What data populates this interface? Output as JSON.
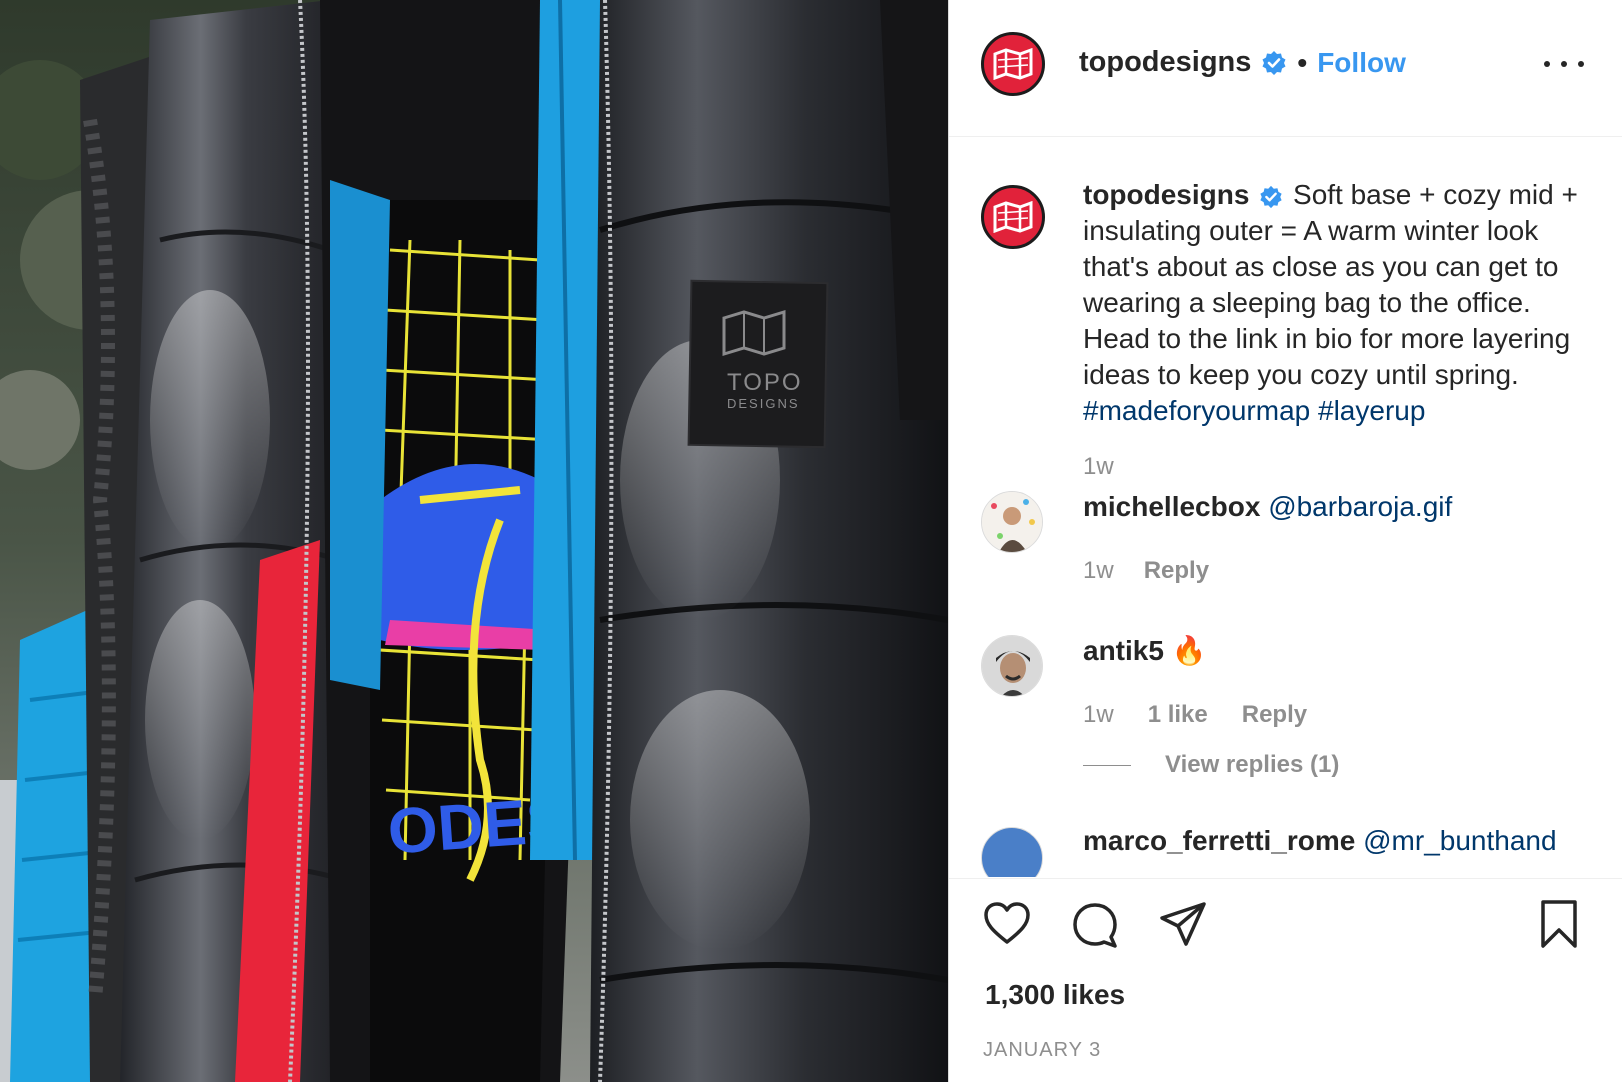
{
  "photo": {
    "logo_line1": "TOPO",
    "logo_line2": "DESIGNS",
    "shirt_text": "ODES"
  },
  "header": {
    "username": "topodesigns",
    "separator": "•",
    "follow_label": "Follow"
  },
  "caption": {
    "username": "topodesigns",
    "text": "Soft base + cozy mid + insulating outer = A warm winter look that's about as close as you can get to wearing a sleeping bag to the office. Head to the link in bio for more layering ideas to keep you cozy until spring.",
    "hashtag1": "#madeforyourmap",
    "hashtag2": "#layerup",
    "time": "1w"
  },
  "comments": [
    {
      "username": "michellecbox",
      "mention": "@barbaroja.gif",
      "time": "1w",
      "reply_label": "Reply"
    },
    {
      "username": "antik5",
      "emoji": "🔥",
      "time": "1w",
      "likes": "1 like",
      "reply_label": "Reply",
      "view_replies": "View replies (1)"
    },
    {
      "username": "marco_ferretti_rome",
      "mention": "@mr_bunthand"
    }
  ],
  "actions": {
    "likes": "1,300 likes",
    "date": "JANUARY 3"
  },
  "colors": {
    "brand_red": "#e1223a",
    "link_blue": "#3897f0",
    "mention_navy": "#00376b",
    "muted": "#8e8e8e"
  },
  "icons": [
    "heart-icon",
    "comment-icon",
    "share-icon",
    "bookmark-icon",
    "verified-badge-icon",
    "more-options-icon"
  ]
}
